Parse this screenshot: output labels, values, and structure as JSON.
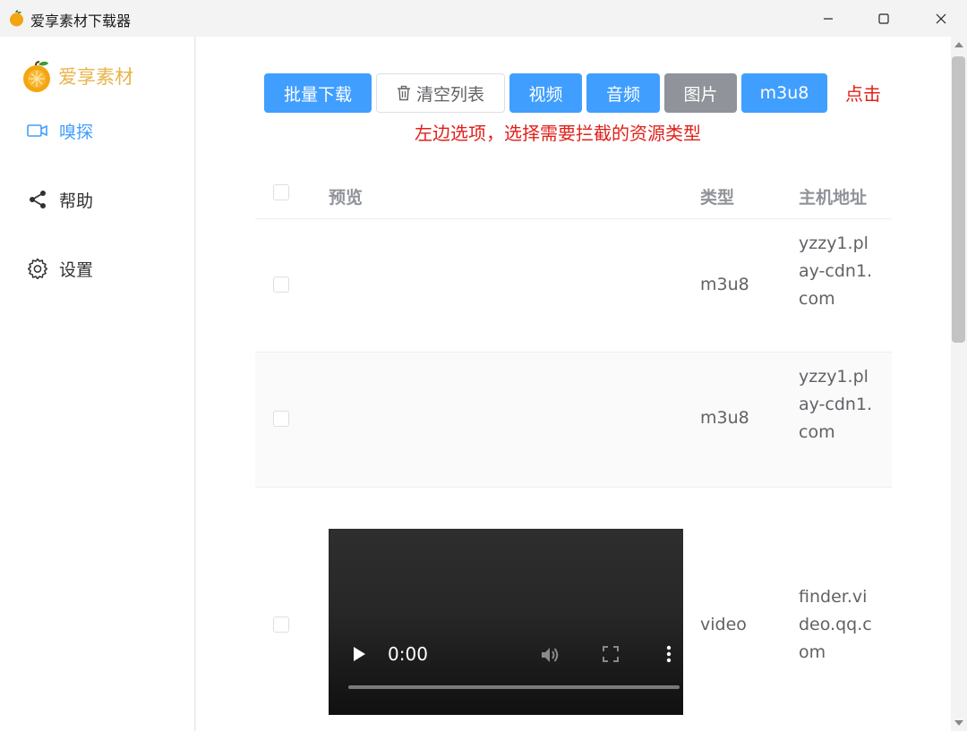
{
  "window": {
    "title": "爱享素材下载器"
  },
  "sidebar": {
    "brand": "爱享素材",
    "items": [
      {
        "label": "嗅探",
        "icon": "video-camera-icon",
        "active": true
      },
      {
        "label": "帮助",
        "icon": "share-icon",
        "active": false
      },
      {
        "label": "设置",
        "icon": "gear-icon",
        "active": false
      }
    ]
  },
  "toolbar": {
    "batch_download": "批量下载",
    "clear_list": "清空列表",
    "filter_video": "视频",
    "filter_audio": "音频",
    "filter_image": "图片",
    "filter_m3u8": "m3u8"
  },
  "hints": {
    "click": "点击",
    "description": "左边选项，选择需要拦截的资源类型"
  },
  "table": {
    "columns": {
      "preview": "预览",
      "type": "类型",
      "host": "主机地址"
    },
    "rows": [
      {
        "type": "m3u8",
        "host": "yzzy1.play-cdn1.com"
      },
      {
        "type": "m3u8",
        "host": "yzzy1.play-cdn1.com"
      },
      {
        "type": "video",
        "host": "finder.video.qq.com",
        "video_time": "0:00"
      }
    ]
  },
  "colors": {
    "primary": "#409eff",
    "gray_button": "#909399",
    "hint_red": "#e0211a",
    "brand_orange": "#e8b54a"
  }
}
